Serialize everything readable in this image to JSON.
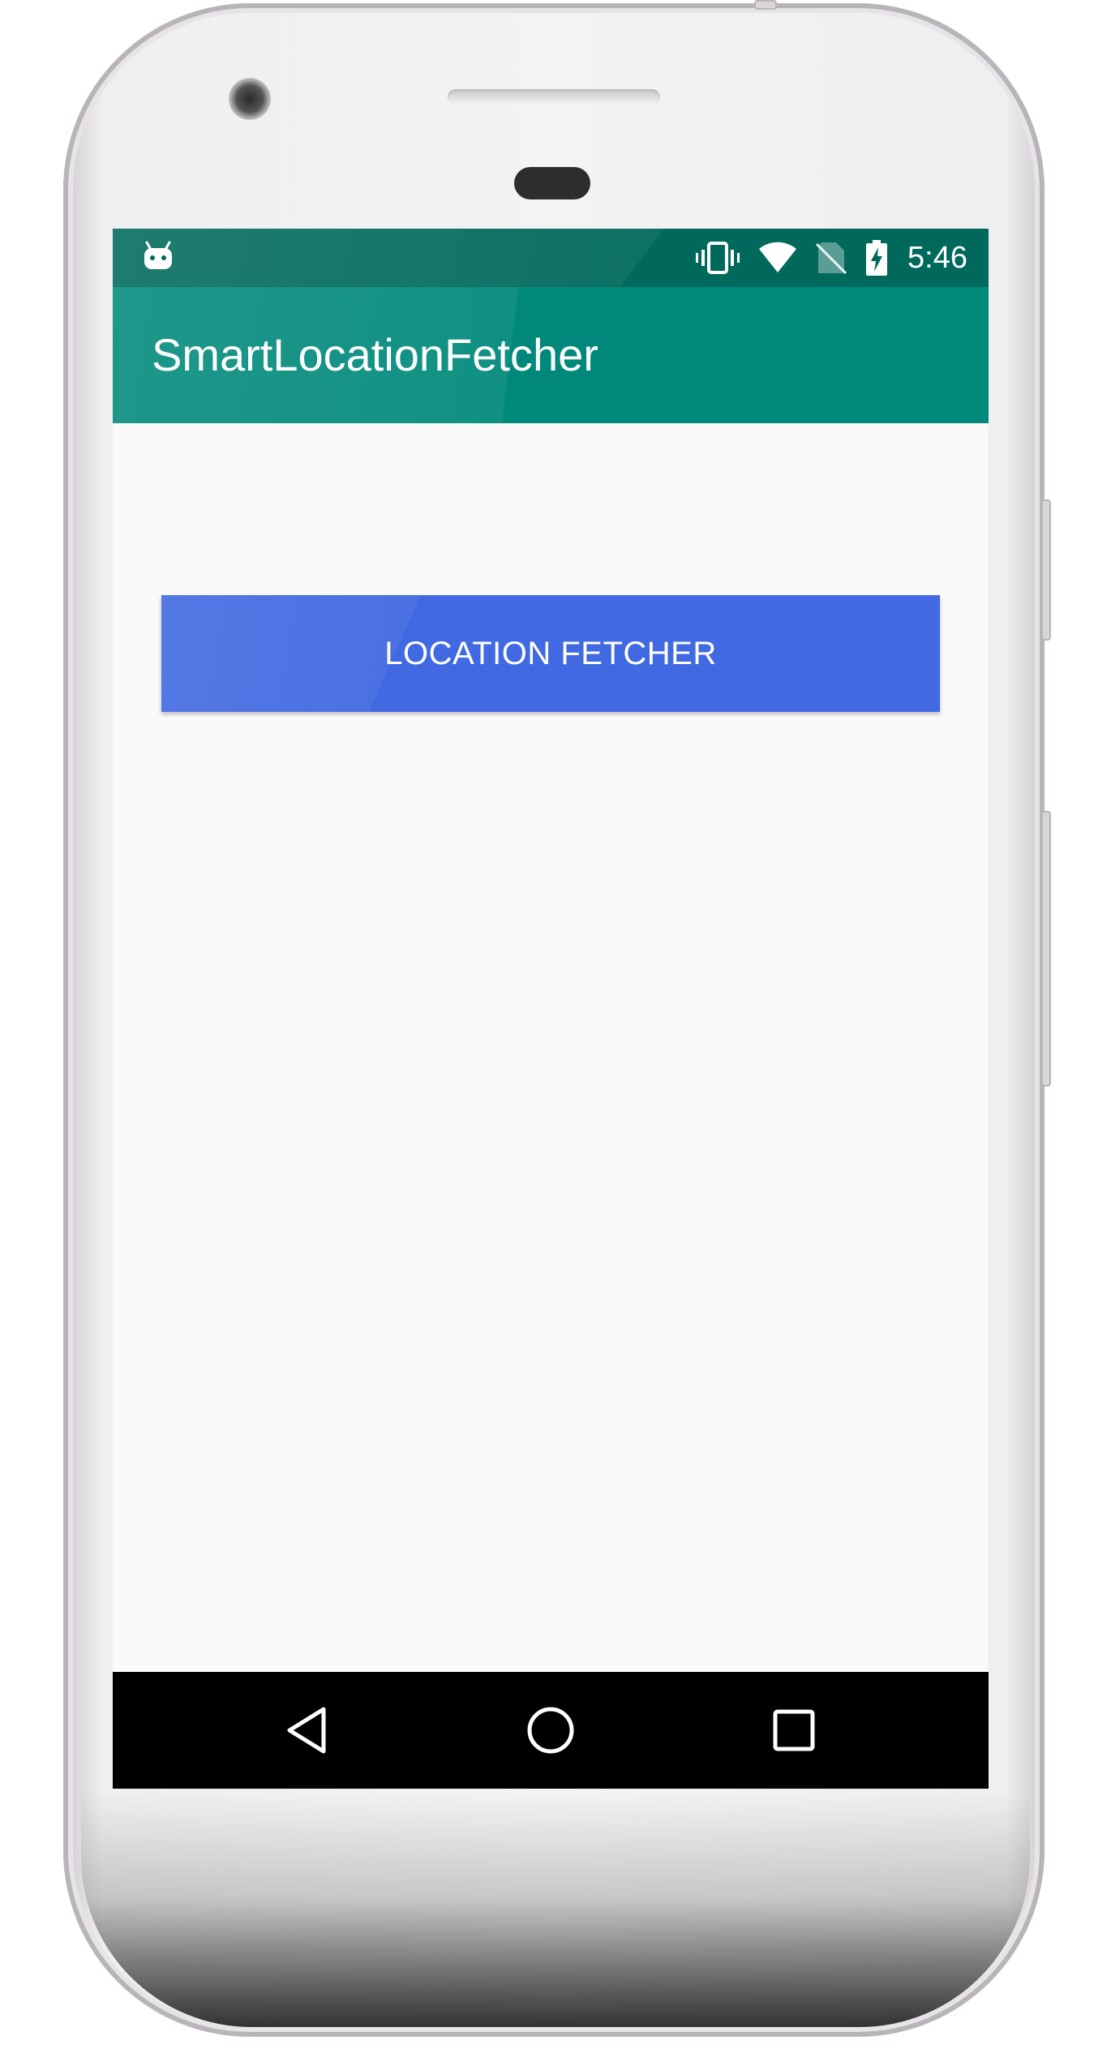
{
  "status_bar": {
    "time": "5:46",
    "icons": [
      "android-debug-icon",
      "vibrate-icon",
      "wifi-icon",
      "no-sim-icon",
      "battery-charging-icon"
    ]
  },
  "app_bar": {
    "title": "SmartLocationFetcher"
  },
  "main": {
    "fetch_button_label": "LOCATION FETCHER"
  },
  "nav_bar": {
    "icons": [
      "back-icon",
      "home-icon",
      "recents-icon"
    ]
  },
  "colors": {
    "status_bar": "#00695c",
    "app_bar": "#00897b",
    "button": "#4169e1",
    "background": "#fafafa",
    "nav_bar": "#000000"
  }
}
